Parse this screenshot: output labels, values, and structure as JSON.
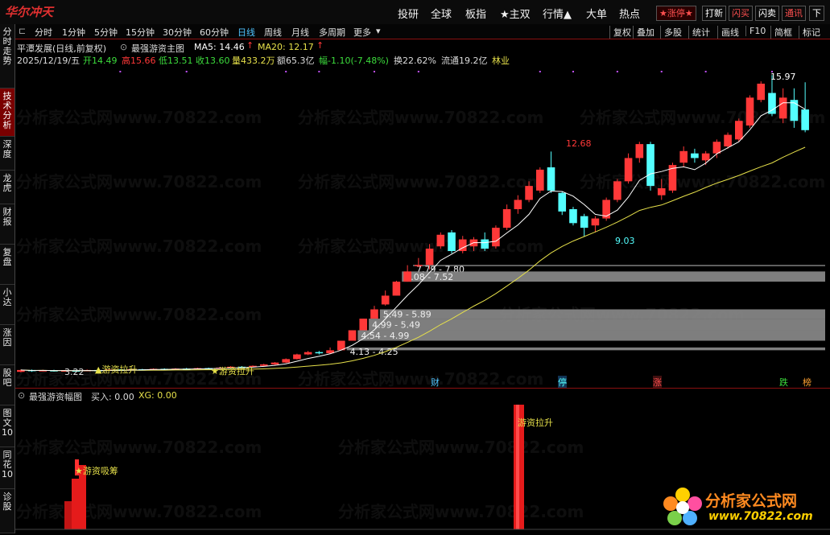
{
  "app": {
    "logo": "华尔冲天"
  },
  "top_nav": [
    "投研",
    "全球",
    "板指",
    "★主双",
    "行情▲",
    "大单",
    "热点"
  ],
  "top_tags": [
    "★涨停★",
    "打新",
    "闪买",
    "闪卖",
    "通讯",
    "下"
  ],
  "sidebar": [
    "分时走势",
    "技术分析",
    "深度",
    "龙虎",
    "财报",
    "复盘",
    "小达",
    "涨因",
    "股吧",
    "图文10",
    "同花10",
    "诊股"
  ],
  "periods": [
    "分时",
    "1分钟",
    "5分钟",
    "15分钟",
    "30分钟",
    "60分钟",
    "日线",
    "周线",
    "月线",
    "多周期",
    "更多"
  ],
  "active_period": "日线",
  "tools": [
    "复权",
    "叠加",
    "多股",
    "统计",
    "画线",
    "F10",
    "简框",
    "标记"
  ],
  "info1": {
    "name": "平潭发展(日线,前复权)",
    "indicator": "最强游资主图",
    "ma5": "MA5: 14.46",
    "ma20": "MA20: 12.17"
  },
  "info2": {
    "date": "2025/12/19/五",
    "open": "开14.49",
    "high": "高15.66",
    "low": "低13.51",
    "close": "收13.60",
    "vol": "量433.2万",
    "amount": "额65.3亿",
    "change": "幅-1.10(-7.48%)",
    "turnover": "换22.62%",
    "float": "流通19.2亿",
    "industry": "林业"
  },
  "price_labels": {
    "peak": "15.97",
    "mid_high": "12.68",
    "mid_low": "9.03",
    "start_low": "3.22"
  },
  "zones": [
    "7.79 - 7.80",
    "7.08 - 7.52",
    "5.49 - 5.89",
    "4.99 - 5.49",
    "4.54 - 4.99",
    "4.13 - 4.25"
  ],
  "markers": {
    "lift1": "游资拉升",
    "lift2": "游资拉升",
    "cai": "财",
    "ting": "停",
    "zhang": "涨",
    "die": "跌",
    "bang": "榜"
  },
  "sub_panel": {
    "title": "最强游资幅图",
    "buy": "买入: 0.00",
    "xg": "XG: 0.00",
    "label_absorb": "★游资吸筹",
    "label_lift": "游资拉升"
  },
  "watermark": "分析家公式网www.70822.com",
  "footer_logo": {
    "title": "分析家公式网",
    "url": "www.70822.com"
  },
  "colors": {
    "up": "#ff3838",
    "down": "#54ffff",
    "ma5": "#ffffff",
    "ma20": "#e6e04a",
    "zone": "#8c8c8c",
    "bg": "#000000"
  },
  "chart_data": {
    "type": "candlestick",
    "y_range": [
      3.0,
      16.5
    ],
    "candles": [
      {
        "o": 3.2,
        "c": 3.28,
        "h": 3.3,
        "l": 3.18
      },
      {
        "o": 3.28,
        "c": 3.24,
        "h": 3.3,
        "l": 3.2
      },
      {
        "o": 3.24,
        "c": 3.27,
        "h": 3.29,
        "l": 3.22
      },
      {
        "o": 3.27,
        "c": 3.23,
        "h": 3.29,
        "l": 3.21
      },
      {
        "o": 3.23,
        "c": 3.26,
        "h": 3.28,
        "l": 3.22
      },
      {
        "o": 3.26,
        "c": 3.24,
        "h": 3.28,
        "l": 3.22
      },
      {
        "o": 3.24,
        "c": 3.28,
        "h": 3.3,
        "l": 3.23
      },
      {
        "o": 3.28,
        "c": 3.25,
        "h": 3.3,
        "l": 3.23
      },
      {
        "o": 3.25,
        "c": 3.3,
        "h": 3.32,
        "l": 3.24
      },
      {
        "o": 3.3,
        "c": 3.27,
        "h": 3.32,
        "l": 3.25
      },
      {
        "o": 3.27,
        "c": 3.31,
        "h": 3.33,
        "l": 3.26
      },
      {
        "o": 3.31,
        "c": 3.29,
        "h": 3.33,
        "l": 3.27
      },
      {
        "o": 3.29,
        "c": 3.33,
        "h": 3.35,
        "l": 3.28
      },
      {
        "o": 3.33,
        "c": 3.3,
        "h": 3.35,
        "l": 3.28
      },
      {
        "o": 3.3,
        "c": 3.34,
        "h": 3.36,
        "l": 3.29
      },
      {
        "o": 3.34,
        "c": 3.32,
        "h": 3.37,
        "l": 3.3
      },
      {
        "o": 3.32,
        "c": 3.36,
        "h": 3.38,
        "l": 3.31
      },
      {
        "o": 3.36,
        "c": 3.34,
        "h": 3.38,
        "l": 3.32
      },
      {
        "o": 3.34,
        "c": 3.38,
        "h": 3.4,
        "l": 3.33
      },
      {
        "o": 3.38,
        "c": 3.42,
        "h": 3.45,
        "l": 3.36
      },
      {
        "o": 3.42,
        "c": 3.4,
        "h": 3.45,
        "l": 3.38
      },
      {
        "o": 3.4,
        "c": 3.46,
        "h": 3.48,
        "l": 3.39
      },
      {
        "o": 3.46,
        "c": 3.52,
        "h": 3.55,
        "l": 3.44
      },
      {
        "o": 3.52,
        "c": 3.6,
        "h": 3.62,
        "l": 3.5
      },
      {
        "o": 3.6,
        "c": 3.75,
        "h": 3.78,
        "l": 3.58
      },
      {
        "o": 3.75,
        "c": 3.95,
        "h": 3.98,
        "l": 3.73
      },
      {
        "o": 3.95,
        "c": 4.05,
        "h": 4.1,
        "l": 3.92
      },
      {
        "o": 4.05,
        "c": 4.0,
        "h": 4.1,
        "l": 3.95
      },
      {
        "o": 4.0,
        "c": 4.13,
        "h": 4.25,
        "l": 3.98
      },
      {
        "o": 4.13,
        "c": 4.54,
        "h": 4.54,
        "l": 4.13
      },
      {
        "o": 4.54,
        "c": 4.99,
        "h": 4.99,
        "l": 4.54
      },
      {
        "o": 4.99,
        "c": 5.49,
        "h": 5.49,
        "l": 4.99
      },
      {
        "o": 5.49,
        "c": 5.89,
        "h": 6.04,
        "l": 5.49
      },
      {
        "o": 6.1,
        "c": 6.48,
        "h": 6.7,
        "l": 6.05
      },
      {
        "o": 6.48,
        "c": 7.08,
        "h": 7.12,
        "l": 6.48
      },
      {
        "o": 7.08,
        "c": 7.52,
        "h": 7.79,
        "l": 7.08
      },
      {
        "o": 7.79,
        "c": 7.8,
        "h": 8.1,
        "l": 7.7
      },
      {
        "o": 7.8,
        "c": 8.5,
        "h": 8.7,
        "l": 7.6
      },
      {
        "o": 8.6,
        "c": 9.1,
        "h": 9.2,
        "l": 8.5
      },
      {
        "o": 9.2,
        "c": 8.4,
        "h": 9.3,
        "l": 8.3
      },
      {
        "o": 8.4,
        "c": 8.9,
        "h": 9.05,
        "l": 8.3
      },
      {
        "o": 8.6,
        "c": 8.9,
        "h": 9.0,
        "l": 8.4
      },
      {
        "o": 8.9,
        "c": 8.5,
        "h": 9.2,
        "l": 8.4
      },
      {
        "o": 8.6,
        "c": 9.4,
        "h": 9.5,
        "l": 8.5
      },
      {
        "o": 9.4,
        "c": 10.2,
        "h": 10.4,
        "l": 9.3
      },
      {
        "o": 10.2,
        "c": 10.6,
        "h": 10.8,
        "l": 10.0
      },
      {
        "o": 10.6,
        "c": 11.2,
        "h": 11.4,
        "l": 10.5
      },
      {
        "o": 11.0,
        "c": 11.9,
        "h": 12.0,
        "l": 10.9
      },
      {
        "o": 12.0,
        "c": 11.0,
        "h": 12.68,
        "l": 10.9
      },
      {
        "o": 10.9,
        "c": 10.1,
        "h": 10.95,
        "l": 9.95
      },
      {
        "o": 10.2,
        "c": 9.6,
        "h": 10.3,
        "l": 9.5
      },
      {
        "o": 9.9,
        "c": 9.4,
        "h": 10.0,
        "l": 9.03
      },
      {
        "o": 9.5,
        "c": 9.8,
        "h": 9.9,
        "l": 9.2
      },
      {
        "o": 9.8,
        "c": 10.6,
        "h": 10.7,
        "l": 9.7
      },
      {
        "o": 10.6,
        "c": 11.4,
        "h": 11.5,
        "l": 10.5
      },
      {
        "o": 11.4,
        "c": 12.4,
        "h": 12.6,
        "l": 11.3
      },
      {
        "o": 12.4,
        "c": 13.0,
        "h": 13.1,
        "l": 12.2
      },
      {
        "o": 13.0,
        "c": 11.2,
        "h": 13.1,
        "l": 11.0
      },
      {
        "o": 10.8,
        "c": 11.1,
        "h": 11.5,
        "l": 10.6
      },
      {
        "o": 11.0,
        "c": 12.1,
        "h": 12.2,
        "l": 10.9
      },
      {
        "o": 12.2,
        "c": 12.7,
        "h": 12.9,
        "l": 12.0
      },
      {
        "o": 12.6,
        "c": 12.4,
        "h": 12.8,
        "l": 12.2
      },
      {
        "o": 12.3,
        "c": 12.6,
        "h": 12.7,
        "l": 12.1
      },
      {
        "o": 12.6,
        "c": 13.1,
        "h": 13.2,
        "l": 12.4
      },
      {
        "o": 12.9,
        "c": 13.4,
        "h": 13.5,
        "l": 12.8
      },
      {
        "o": 13.2,
        "c": 14.0,
        "h": 14.1,
        "l": 13.1
      },
      {
        "o": 13.8,
        "c": 15.0,
        "h": 15.1,
        "l": 13.7
      },
      {
        "o": 14.9,
        "c": 15.6,
        "h": 15.7,
        "l": 14.8
      },
      {
        "o": 15.2,
        "c": 14.3,
        "h": 15.97,
        "l": 14.2
      },
      {
        "o": 14.1,
        "c": 15.0,
        "h": 15.4,
        "l": 13.9
      },
      {
        "o": 14.9,
        "c": 14.0,
        "h": 15.4,
        "l": 13.7
      },
      {
        "o": 14.49,
        "c": 13.6,
        "h": 15.66,
        "l": 13.51
      }
    ],
    "zones": [
      {
        "lo": 7.79,
        "hi": 7.8,
        "start_idx": 36
      },
      {
        "lo": 7.08,
        "hi": 7.52,
        "start_idx": 35
      },
      {
        "lo": 5.49,
        "hi": 5.89,
        "start_idx": 33
      },
      {
        "lo": 4.99,
        "hi": 5.49,
        "start_idx": 32
      },
      {
        "lo": 4.54,
        "hi": 4.99,
        "start_idx": 31
      },
      {
        "lo": 4.13,
        "hi": 4.25,
        "start_idx": 30
      }
    ],
    "ma5_label": "MA5",
    "ma20_label": "MA20"
  }
}
